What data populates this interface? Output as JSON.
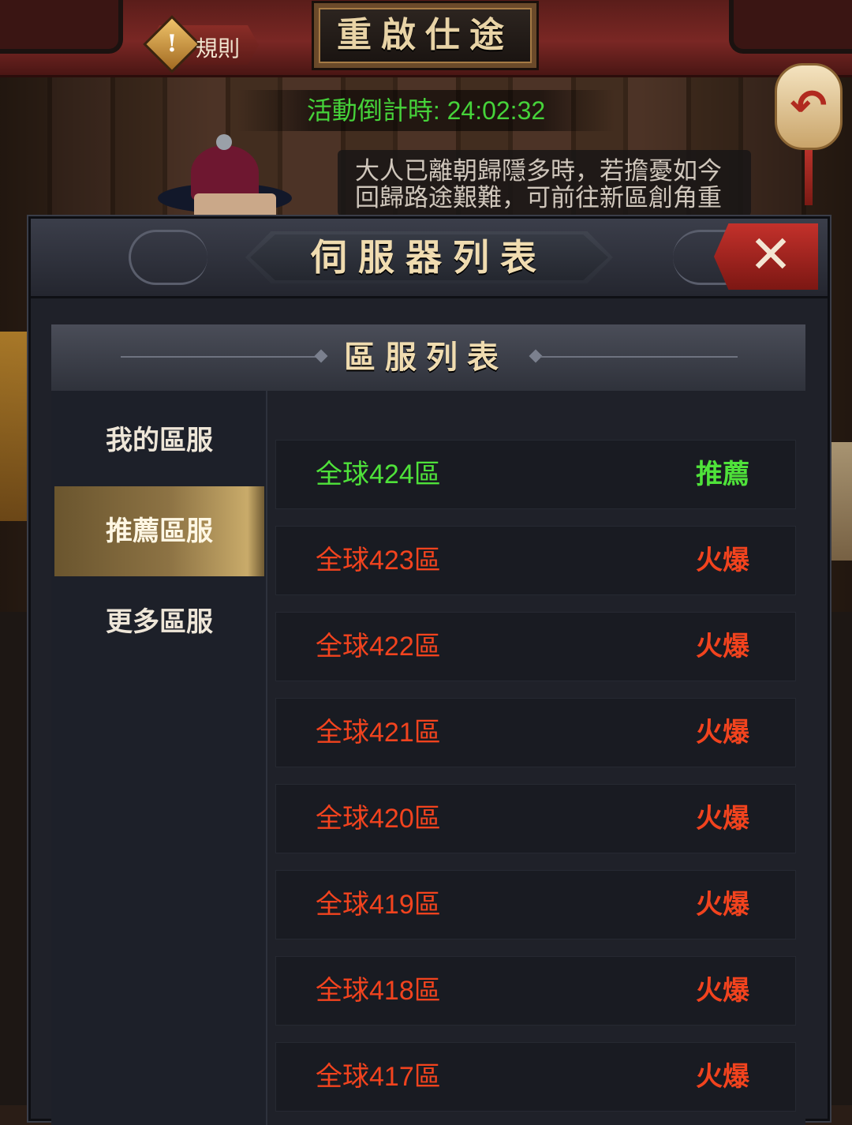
{
  "colors": {
    "recommended": "#4fe23a",
    "hot": "#f2431e",
    "countdown": "#46d33a",
    "title_gold": "#f0dcb0"
  },
  "topbar": {
    "rules_label": "規則",
    "title": "重啟仕途",
    "countdown_text": "活動倒計時:  24:02:32"
  },
  "speech": {
    "lines": [
      "大人已離朝歸隱多時，若擔憂如今",
      "回歸路途艱難，可前往新區創角重"
    ]
  },
  "modal": {
    "title": "伺服器列表",
    "section_title": "區服列表",
    "sidebar": [
      {
        "label": "我的區服",
        "active": false
      },
      {
        "label": "推薦區服",
        "active": true
      },
      {
        "label": "更多區服",
        "active": false
      }
    ],
    "servers": [
      {
        "name": "全球424區",
        "status": "推薦",
        "kind": "recommended"
      },
      {
        "name": "全球423區",
        "status": "火爆",
        "kind": "hot"
      },
      {
        "name": "全球422區",
        "status": "火爆",
        "kind": "hot"
      },
      {
        "name": "全球421區",
        "status": "火爆",
        "kind": "hot"
      },
      {
        "name": "全球420區",
        "status": "火爆",
        "kind": "hot"
      },
      {
        "name": "全球419區",
        "status": "火爆",
        "kind": "hot"
      },
      {
        "name": "全球418區",
        "status": "火爆",
        "kind": "hot"
      },
      {
        "name": "全球417區",
        "status": "火爆",
        "kind": "hot"
      }
    ]
  }
}
